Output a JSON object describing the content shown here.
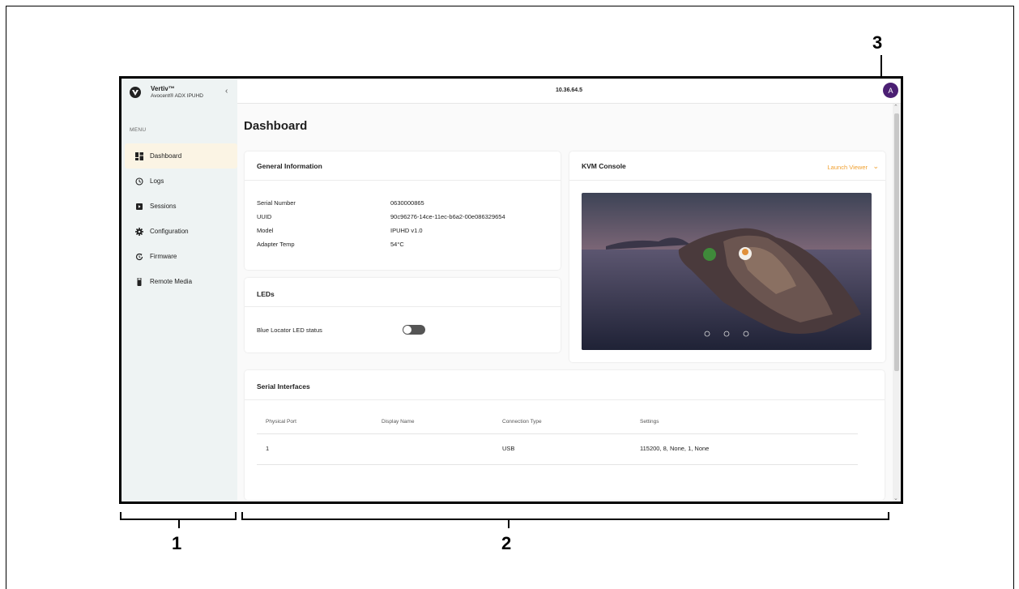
{
  "app": {
    "brand_name": "Vertiv™",
    "brand_sub": "Avocent® ADX IPUHD",
    "collapse_icon": "chevron-left-icon"
  },
  "topbar": {
    "ip_address": "10.36.64.5",
    "avatar_initial": "A"
  },
  "sidebar": {
    "menu_label": "MENU",
    "items": [
      {
        "label": "Dashboard",
        "icon": "dashboard-icon",
        "active": true
      },
      {
        "label": "Logs",
        "icon": "history-icon",
        "active": false
      },
      {
        "label": "Sessions",
        "icon": "sessions-icon",
        "active": false
      },
      {
        "label": "Configuration",
        "icon": "gear-icon",
        "active": false
      },
      {
        "label": "Firmware",
        "icon": "refresh-icon",
        "active": false
      },
      {
        "label": "Remote Media",
        "icon": "usb-icon",
        "active": false
      }
    ]
  },
  "page": {
    "title": "Dashboard"
  },
  "general_info": {
    "title": "General Information",
    "rows": [
      {
        "label": "Serial Number",
        "value": "0630000865"
      },
      {
        "label": "UUID",
        "value": "90c96276-14ce-11ec-b6a2-00e086329654"
      },
      {
        "label": "Model",
        "value": "IPUHD v1.0"
      },
      {
        "label": "Adapter Temp",
        "value": "54°C"
      }
    ]
  },
  "leds": {
    "title": "LEDs",
    "blue_locator_label": "Blue Locator LED status",
    "blue_locator_on": false
  },
  "kvm": {
    "title": "KVM Console",
    "launch_label": "Launch Viewer"
  },
  "serial_interfaces": {
    "title": "Serial Interfaces",
    "columns": [
      "Physical Port",
      "Display Name",
      "Connection Type",
      "Settings"
    ],
    "rows": [
      {
        "port": "1",
        "display_name": "",
        "connection_type": "USB",
        "settings": "115200, 8, None, 1, None"
      }
    ]
  },
  "callouts": {
    "sidebar": "1",
    "main": "2",
    "user": "3"
  },
  "colors": {
    "accent": "#f0a030",
    "avatar": "#4b1f73",
    "active_nav": "#fbf4e4",
    "sidebar_bg": "#eef3f3"
  }
}
